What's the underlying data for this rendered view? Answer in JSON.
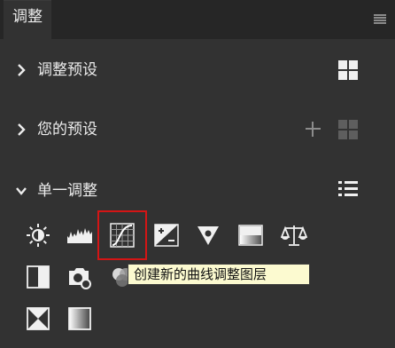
{
  "panel": {
    "tab_title": "调整"
  },
  "sections": {
    "adjust_presets": {
      "title": "调整预设"
    },
    "your_presets": {
      "title": "您的预设"
    },
    "single_adjust": {
      "title": "单一调整"
    }
  },
  "tooltip": {
    "text": "创建新的曲线调整图层"
  },
  "icons": [
    "brightness-contrast-icon",
    "levels-icon",
    "curves-icon",
    "exposure-icon",
    "vibrance-icon",
    "hue-saturation-icon",
    "color-balance-icon",
    "black-white-icon",
    "photo-filter-icon",
    "channel-mixer-icon",
    "invert-icon",
    "gradient-map-icon"
  ]
}
